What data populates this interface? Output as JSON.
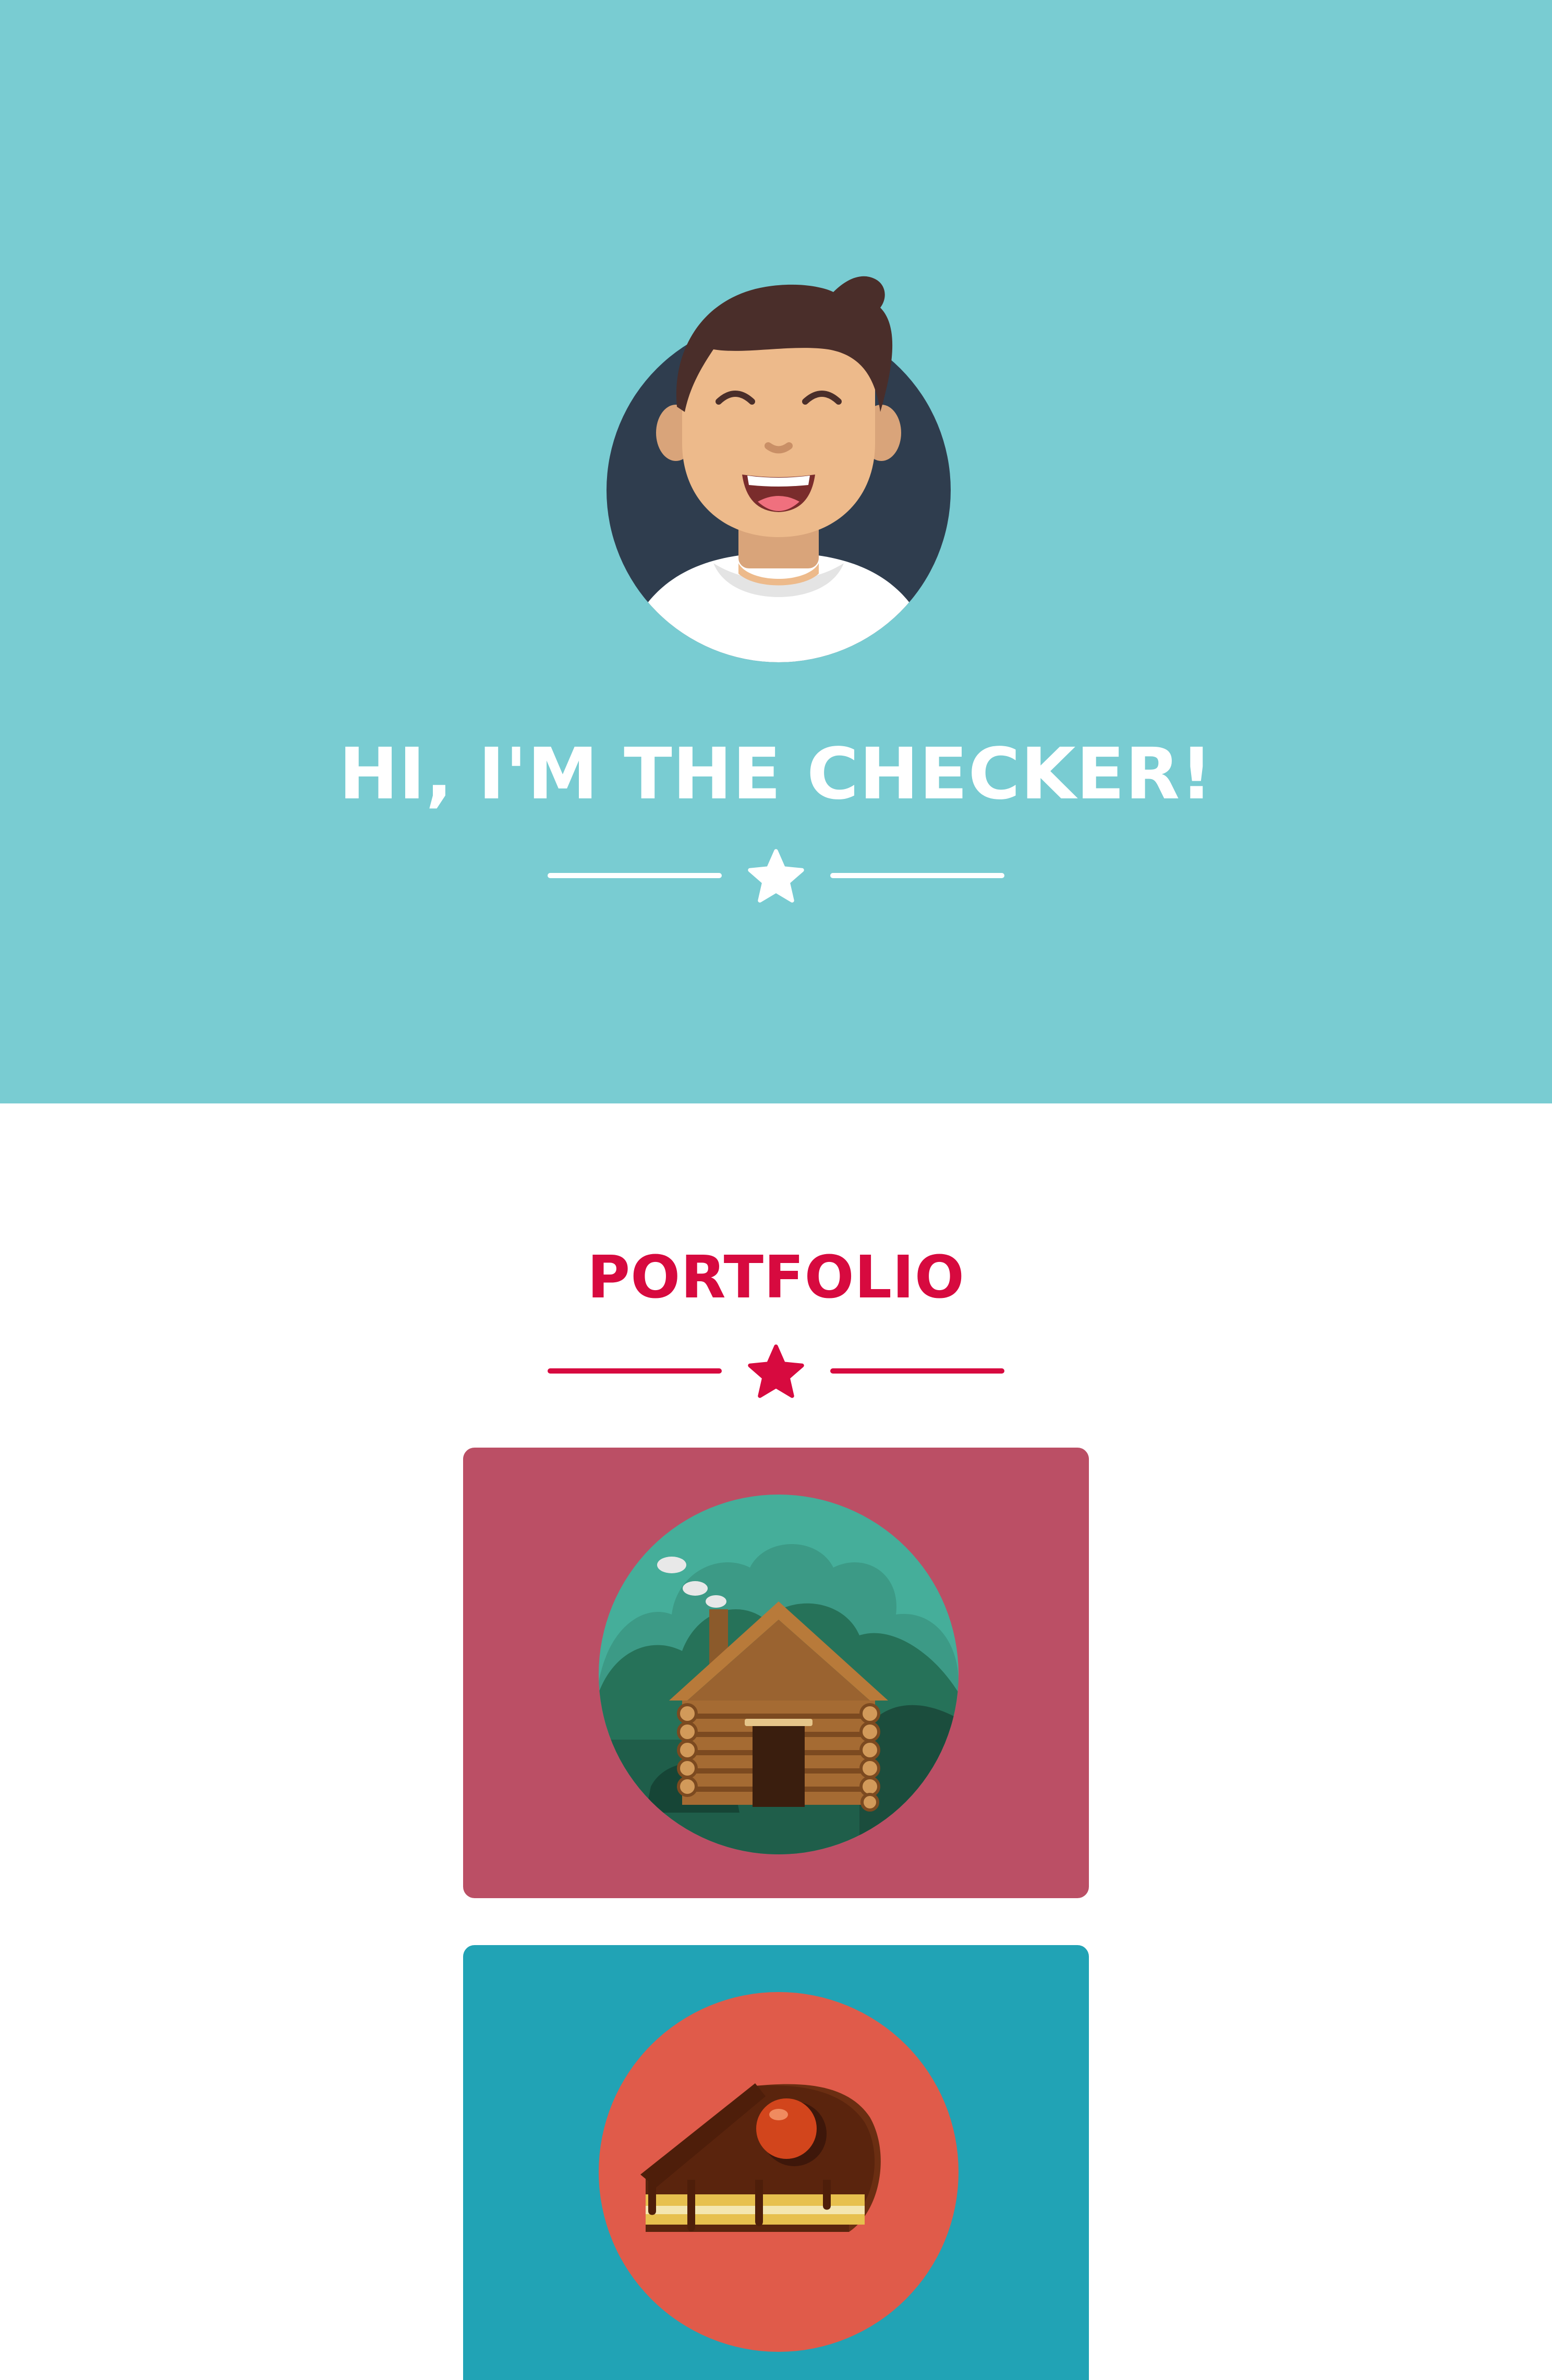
{
  "masthead": {
    "title": "HI, I'M THE CHECKER!",
    "background_color": "#79CCD2",
    "avatar_icon": "smiling-person-avatar-icon",
    "divider_icon": "star-icon"
  },
  "portfolio": {
    "title": "PORTFOLIO",
    "accent_color": "#D70A3F",
    "divider_icon": "star-icon",
    "items": [
      {
        "icon": "log-cabin-icon",
        "color": "#BB4F65"
      },
      {
        "icon": "cake-slice-icon",
        "color": "#21A3B5"
      }
    ]
  }
}
